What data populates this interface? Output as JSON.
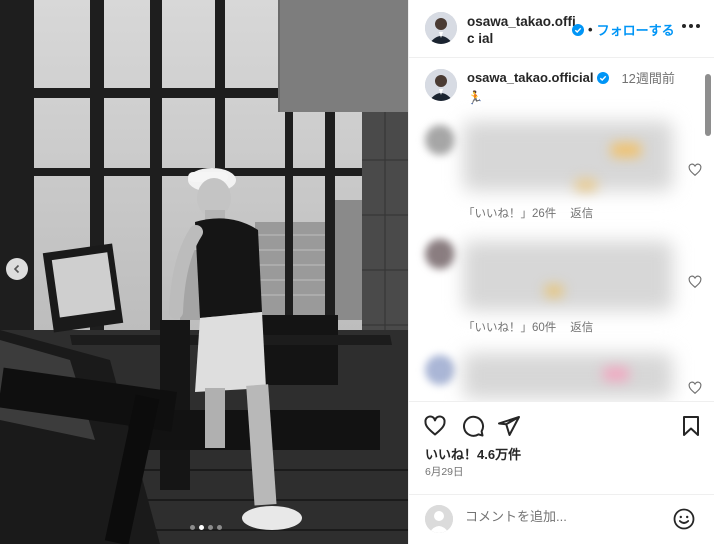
{
  "post": {
    "username": "osawa_takao.official",
    "username_wrapped": "osawa_takao.offic ial",
    "follow_separator": "•",
    "follow_label": "フォローする",
    "caption_time": "12週間前",
    "caption_emoji": "🏃",
    "likes_text": "いいね！4.6万件",
    "date_text": "6月29日",
    "carousel": {
      "total_slides": 4,
      "active_slide": 2
    }
  },
  "comments": [
    {
      "likes_label": "「いいね！」26件",
      "reply_label": "返信"
    },
    {
      "likes_label": "「いいね！」60件",
      "reply_label": "返信"
    },
    {
      "likes_label": "",
      "reply_label": ""
    }
  ],
  "composer": {
    "placeholder": "コメントを追加..."
  },
  "icons": {
    "verified": "verified-badge-icon",
    "like": "heart-icon",
    "comment": "comment-icon",
    "share": "send-icon",
    "save": "bookmark-icon",
    "emoji": "smile-icon",
    "more": "more-options-icon"
  },
  "colors": {
    "accent": "#0095f6",
    "text": "#262626",
    "muted": "#737373",
    "border": "#efefef"
  }
}
